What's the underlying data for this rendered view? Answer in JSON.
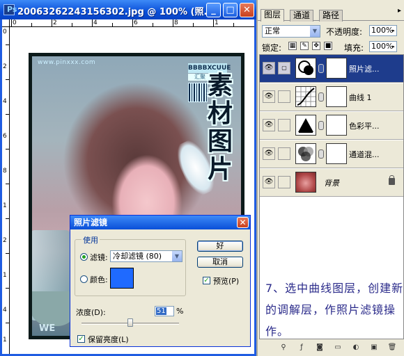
{
  "document": {
    "title": "20063262243156302.jpg @ 100% (照...",
    "app_icon": "Ps",
    "window_buttons": {
      "minimize": "_",
      "maximize": "□",
      "close": "✕"
    },
    "rulers": {
      "top": [
        "0",
        "2",
        "4",
        "6",
        "8",
        "1"
      ],
      "left": [
        "0",
        "2",
        "4",
        "6",
        "8",
        "1",
        "2",
        "1",
        "4",
        "1"
      ]
    },
    "photo": {
      "watermark": "www.pinxxx.com",
      "stamp_tag": "BBBBXCUUE",
      "stamp_small": "汇聚",
      "big_chars": "素材图片",
      "bottom_text": "WE"
    }
  },
  "photo_filter_dialog": {
    "title": "照片滤镜",
    "close": "✕",
    "use_group_label": "使用",
    "filter_label": "滤镜:",
    "filter_value": "冷却滤镜 (80)",
    "color_label": "颜色:",
    "color_value": "#1f6aff",
    "ok_label": "好",
    "cancel_label": "取消",
    "preview_label": "预览(P)",
    "density_label": "浓度(D):",
    "density_value": "51",
    "density_unit": "%",
    "preserve_label": "保留亮度(L)"
  },
  "layers_panel": {
    "tabs": [
      "图层",
      "通道",
      "路径"
    ],
    "menu_icon": "▸",
    "blend_mode": "正常",
    "opacity_label": "不透明度:",
    "opacity_value": "100%",
    "lock_label": "锁定:",
    "fill_label": "填充:",
    "fill_value": "100%",
    "layers": [
      {
        "name": "照片滤...",
        "selected": true
      },
      {
        "name": "曲线 1",
        "selected": false
      },
      {
        "name": "色彩平...",
        "selected": false
      },
      {
        "name": "通道混...",
        "selected": false
      },
      {
        "name": "背景",
        "selected": false
      }
    ],
    "instruction": "7、选中曲线图层，创建新的调解层，作照片滤镜操作。"
  }
}
